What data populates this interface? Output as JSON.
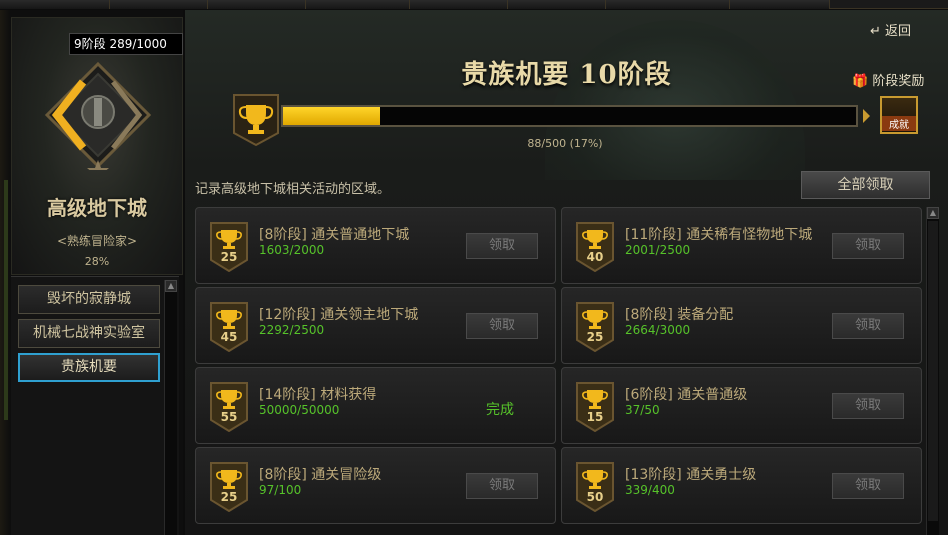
{
  "left": {
    "stage_badge": "9阶段 289/1000",
    "rank_title": "高级地下城",
    "rank_subtitle": "<熟练冒险家>",
    "rank_percent": "28%",
    "items": [
      {
        "label": "毁坏的寂静城"
      },
      {
        "label": "机械七战神实验室"
      },
      {
        "label": "贵族机要"
      }
    ]
  },
  "main": {
    "back_label": "返回",
    "title": "贵族机要 10阶段",
    "stage_reward_label": "阶段奖励",
    "chest_label": "成就",
    "progress_text": "88/500 (17%)",
    "progress_fraction": 0.17,
    "description": "记录高级地下城相关活动的区域。",
    "claim_all_label": "全部领取"
  },
  "achievements": [
    {
      "level": "25",
      "title": "[8阶段] 通关普通地下城",
      "progress": "1603/2000",
      "action": "领取",
      "done": false
    },
    {
      "level": "40",
      "title": "[11阶段] 通关稀有怪物地下城",
      "progress": "2001/2500",
      "action": "领取",
      "done": false
    },
    {
      "level": "45",
      "title": "[12阶段] 通关领主地下城",
      "progress": "2292/2500",
      "action": "领取",
      "done": false
    },
    {
      "level": "25",
      "title": "[8阶段] 装备分配",
      "progress": "2664/3000",
      "action": "领取",
      "done": false
    },
    {
      "level": "55",
      "title": "[14阶段] 材料获得",
      "progress": "50000/50000",
      "action": "完成",
      "done": true
    },
    {
      "level": "15",
      "title": "[6阶段] 通关普通级",
      "progress": "37/50",
      "action": "领取",
      "done": false
    },
    {
      "level": "25",
      "title": "[8阶段] 通关冒险级",
      "progress": "97/100",
      "action": "领取",
      "done": false
    },
    {
      "level": "50",
      "title": "[13阶段] 通关勇士级",
      "progress": "339/400",
      "action": "领取",
      "done": false
    }
  ],
  "colors": {
    "accent_gold": "#ffd52a",
    "progress_green": "#56c22a",
    "active_border": "#2fa0d0"
  }
}
